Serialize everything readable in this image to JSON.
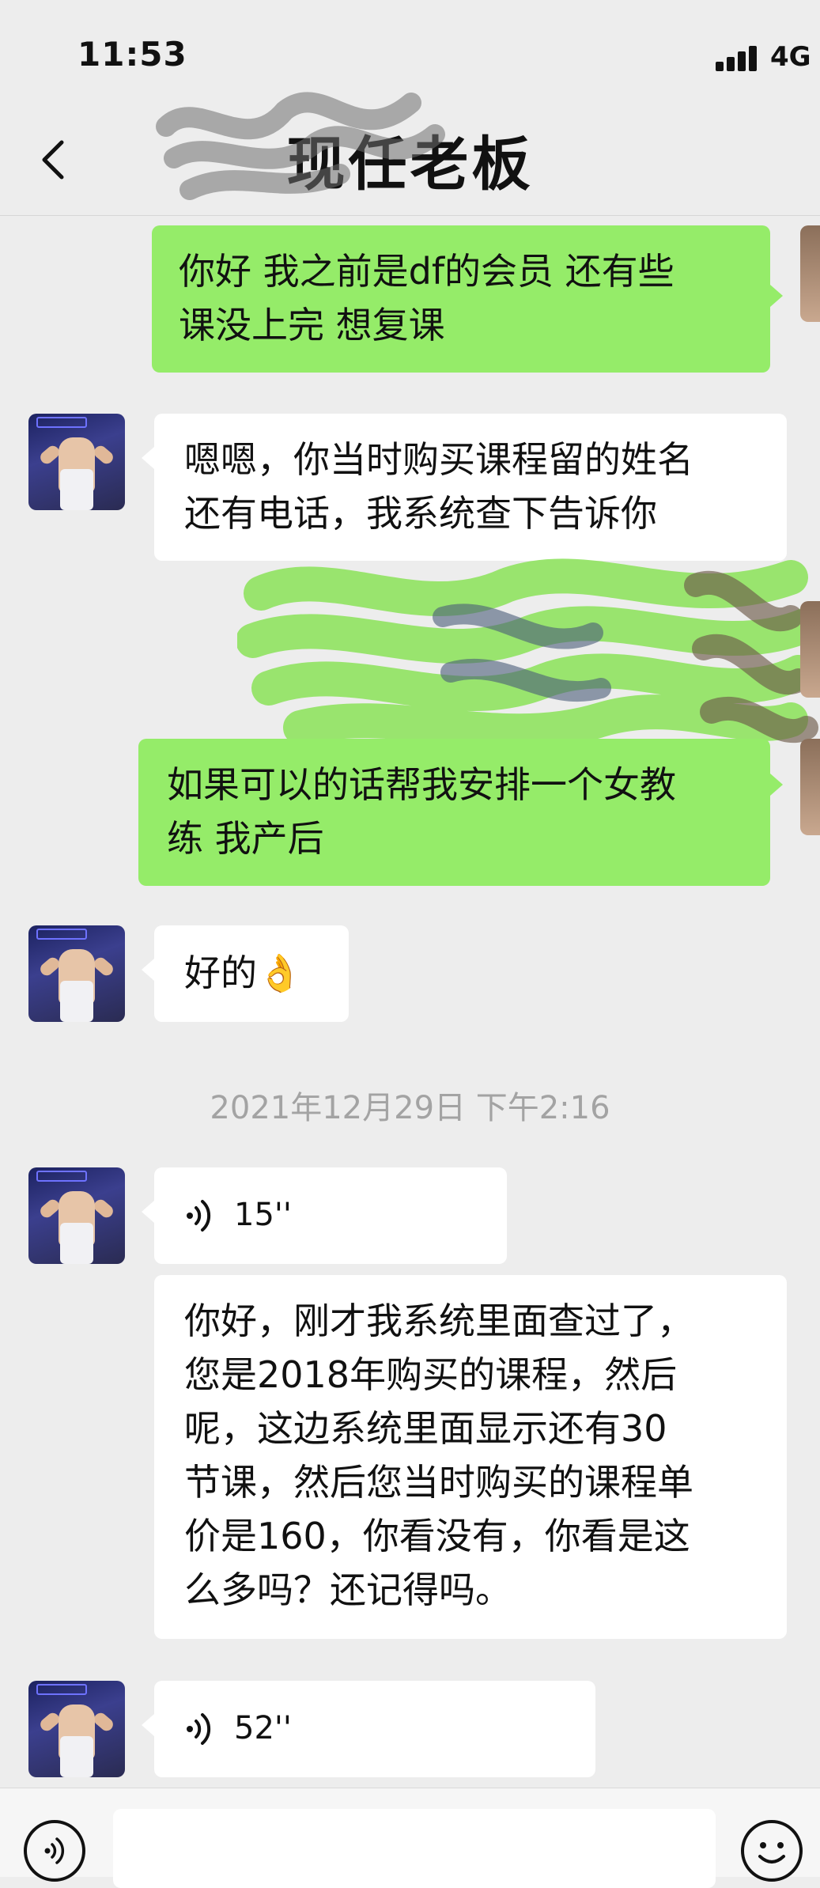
{
  "status_bar": {
    "time": "11:53",
    "network": "4G"
  },
  "nav": {
    "title": "现任老板"
  },
  "messages": [
    {
      "side": "out",
      "text": "你好 我之前是df的会员 还有些\n课没上完 想复课"
    },
    {
      "side": "in",
      "text": "嗯嗯，你当时购买课程留的姓名\n还有电话，我系统查下告诉你"
    },
    {
      "side": "out",
      "text": "如果可以的话帮我安排一个女教\n练 我产后"
    },
    {
      "side": "in",
      "text": "好的👌"
    },
    {
      "side": "in",
      "type": "voice",
      "duration": "15''"
    },
    {
      "side": "in",
      "text": "你好，刚才我系统里面查过了，\n您是2018年购买的课程，然后\n呢，这边系统里面显示还有30\n节课，然后您当时购买的课程单\n价是160，你看没有，你看是这\n么多吗？还记得吗。"
    },
    {
      "side": "in",
      "type": "voice",
      "duration": "52''"
    }
  ],
  "timestamp": "2021年12月29日 下午2:16",
  "icons": {
    "back": "chevron-left-icon",
    "voice": "voice-wave-icon",
    "voice_input": "voice-input-icon",
    "emoji": "emoji-icon"
  },
  "colors": {
    "outgoing_bubble": "#95ec69",
    "incoming_bubble": "#ffffff",
    "background": "#ededed"
  }
}
